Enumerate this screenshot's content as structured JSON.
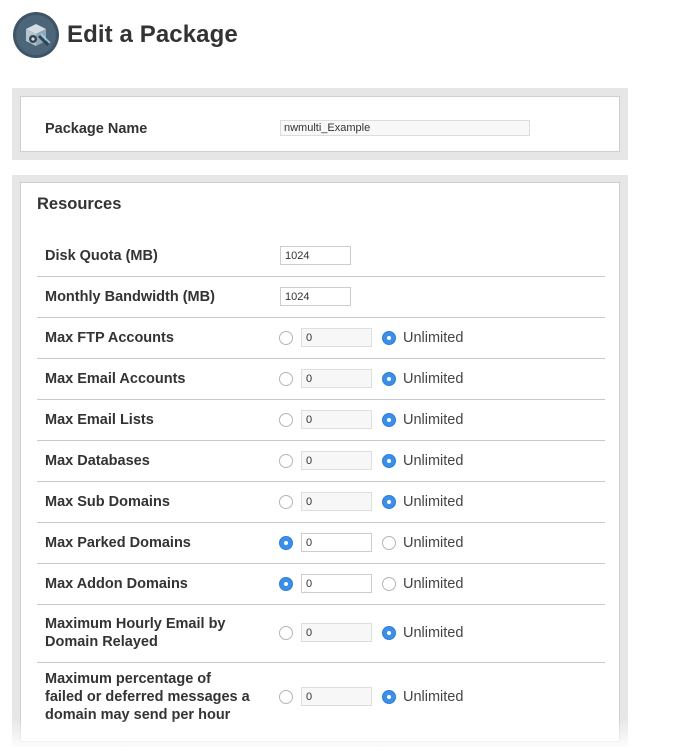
{
  "header": {
    "title": "Edit a Package",
    "icon": "package-edit-icon"
  },
  "package": {
    "label": "Package Name",
    "value": "nwmulti_Example"
  },
  "resources": {
    "title": "Resources",
    "rows": [
      {
        "label": "Disk Quota (MB)",
        "value": "1024"
      },
      {
        "label": "Monthly Bandwidth (MB)",
        "value": "1024"
      },
      {
        "label": "Max FTP Accounts",
        "value": "0",
        "unlimited_label": "Unlimited",
        "selected": "unlimited"
      },
      {
        "label": "Max Email Accounts",
        "value": "0",
        "unlimited_label": "Unlimited",
        "selected": "unlimited"
      },
      {
        "label": "Max Email Lists",
        "value": "0",
        "unlimited_label": "Unlimited",
        "selected": "unlimited"
      },
      {
        "label": "Max Databases",
        "value": "0",
        "unlimited_label": "Unlimited",
        "selected": "unlimited"
      },
      {
        "label": "Max Sub Domains",
        "value": "0",
        "unlimited_label": "Unlimited",
        "selected": "unlimited"
      },
      {
        "label": "Max Parked Domains",
        "value": "0",
        "unlimited_label": "Unlimited",
        "selected": "value"
      },
      {
        "label": "Max Addon Domains",
        "value": "0",
        "unlimited_label": "Unlimited",
        "selected": "value"
      },
      {
        "label_lines": [
          "Maximum Hourly Email by",
          "Domain Relayed"
        ],
        "value": "0",
        "unlimited_label": "Unlimited",
        "selected": "unlimited"
      },
      {
        "label_lines": [
          "Maximum percentage of",
          "failed or deferred messages a",
          "domain may send per hour"
        ],
        "value": "0",
        "unlimited_label": "Unlimited",
        "selected": "unlimited"
      }
    ]
  },
  "colors": {
    "accent": "#3b8ee9",
    "panel_bg": "#e6e6e6",
    "text": "#333333"
  }
}
